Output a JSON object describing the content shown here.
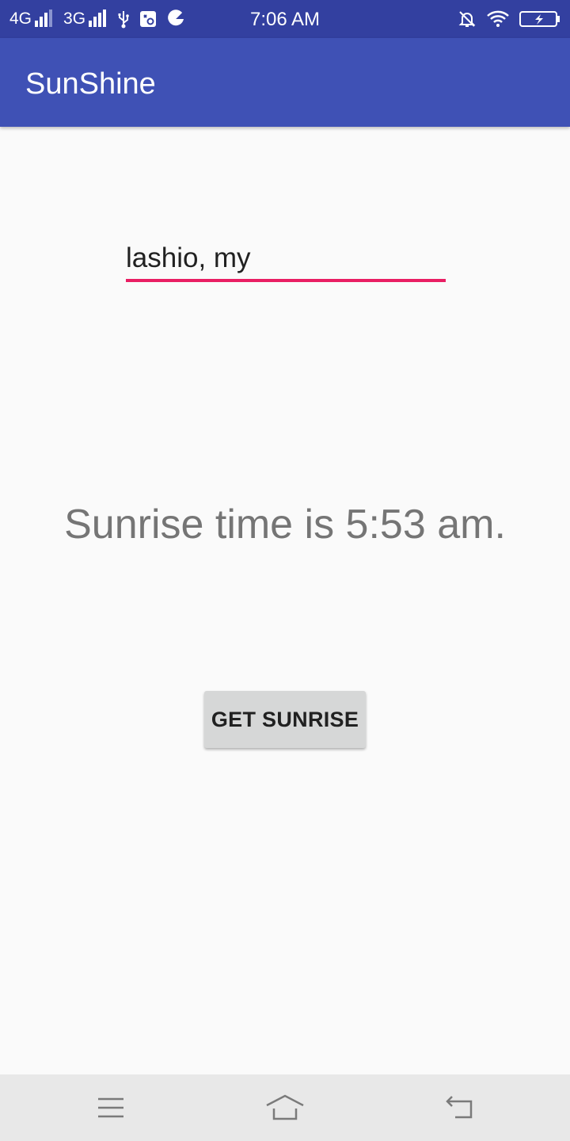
{
  "status_bar": {
    "network1": "4G",
    "network2": "3G",
    "time": "7:06 AM",
    "icons": [
      "usb-icon",
      "settings-notification-icon",
      "pacman-icon",
      "bell-off-icon",
      "wifi-icon",
      "battery-charging-icon"
    ],
    "background": "#3340a0"
  },
  "app_bar": {
    "title": "SunShine",
    "background": "#3f51b5"
  },
  "main": {
    "city_input": {
      "value": "lashio, my",
      "underline_color": "#e91e63"
    },
    "result": "Sunrise time is 5:53 am.",
    "button_label": "GET SUNRISE"
  },
  "nav_bar": {
    "items": [
      "menu-icon",
      "home-icon",
      "back-icon"
    ]
  }
}
